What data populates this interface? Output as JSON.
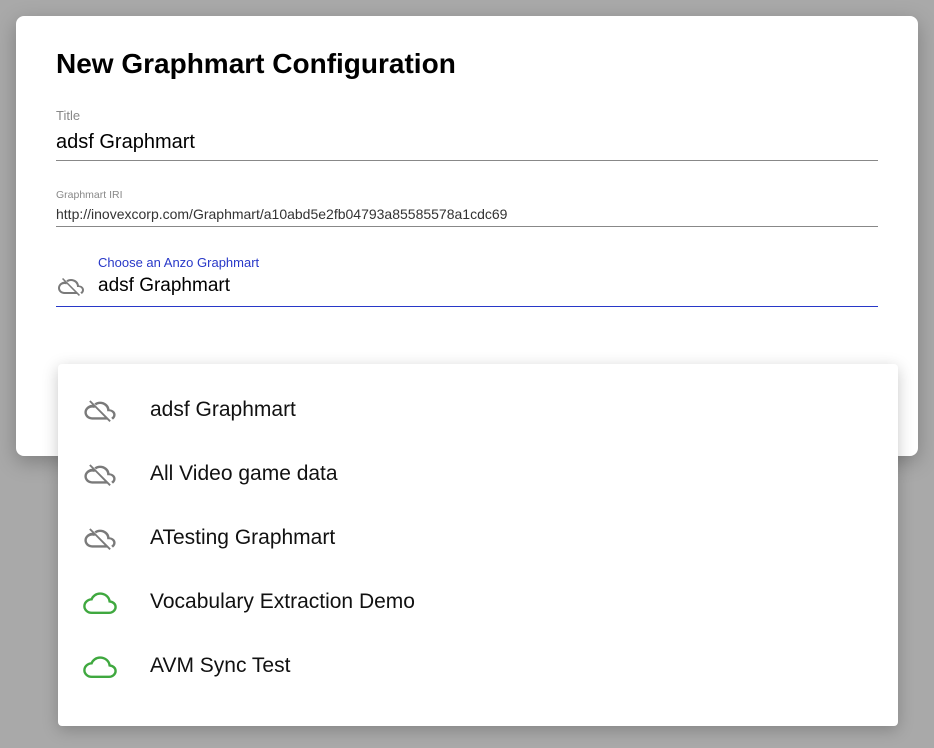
{
  "header": {
    "title": "New Graphmart Configuration"
  },
  "fields": {
    "title_label": "Title",
    "title_value": "adsf Graphmart",
    "iri_label": "Graphmart IRI",
    "iri_value": "http://inovexcorp.com/Graphmart/a10abd5e2fb04793a85585578a1cdc69"
  },
  "combobox": {
    "label": "Choose an Anzo Graphmart",
    "value": "adsf Graphmart",
    "selected_icon": "cloud-off"
  },
  "dropdown": {
    "options": [
      {
        "label": "adsf Graphmart",
        "icon": "cloud-off"
      },
      {
        "label": "All Video game data",
        "icon": "cloud-off"
      },
      {
        "label": "ATesting Graphmart",
        "icon": "cloud-off"
      },
      {
        "label": "Vocabulary Extraction Demo",
        "icon": "cloud-on"
      },
      {
        "label": "AVM Sync Test",
        "icon": "cloud-on"
      }
    ]
  },
  "icons": {
    "cloud-off": "cloud-off-icon",
    "cloud-on": "cloud-icon"
  },
  "colors": {
    "accent": "#2838c8",
    "success": "#3fa83f",
    "muted": "#7a7a7a"
  }
}
